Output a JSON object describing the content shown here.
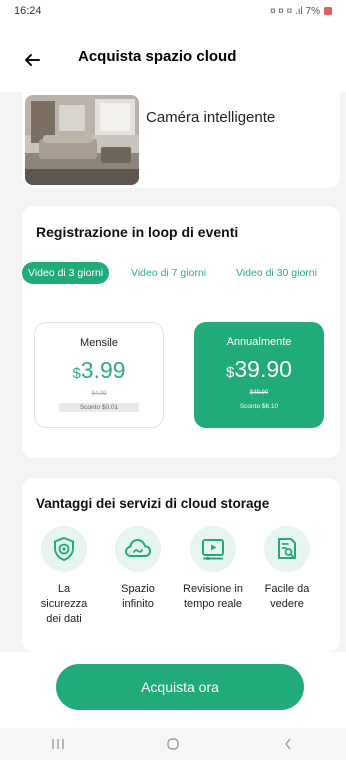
{
  "status_bar": {
    "time": "16:24",
    "indicators": "¤ ¤ ¤ .ıl 7%"
  },
  "header": {
    "title": "Acquista spazio cloud",
    "back_icon": "arrow-left-icon"
  },
  "device": {
    "name": "Caméra intelligente"
  },
  "recording": {
    "title": "Registrazione in loop di eventi",
    "tabs": [
      {
        "label": "Video di 3 giorni",
        "active": true
      },
      {
        "label": "Video di 7 giorni",
        "active": false
      },
      {
        "label": "Video di 30 giorni",
        "active": false
      }
    ],
    "plans": [
      {
        "name": "Mensile",
        "currency": "$",
        "price": "3.99",
        "old_price": "$4.99",
        "discount": "Sconto $0.01",
        "selected": false
      },
      {
        "name": "Annualmente",
        "currency": "$",
        "price": "39.90",
        "old_price": "$49.90",
        "discount": "Sconto $6.10",
        "selected": true
      }
    ]
  },
  "benefits": {
    "title": "Vantaggi dei servizi di cloud storage",
    "items": [
      {
        "label": "La sicurezza dei dati",
        "icon": "shield-icon"
      },
      {
        "label": "Spazio infinito",
        "icon": "cloud-icon"
      },
      {
        "label": "Revisione in tempo reale",
        "icon": "video-play-icon"
      },
      {
        "label": "Facile da vedere",
        "icon": "document-search-icon"
      }
    ]
  },
  "footer": {
    "buy_label": "Acquista ora"
  },
  "colors": {
    "accent": "#21ab78",
    "accent_light": "#e6f5ee",
    "background": "#f3f4f3"
  }
}
